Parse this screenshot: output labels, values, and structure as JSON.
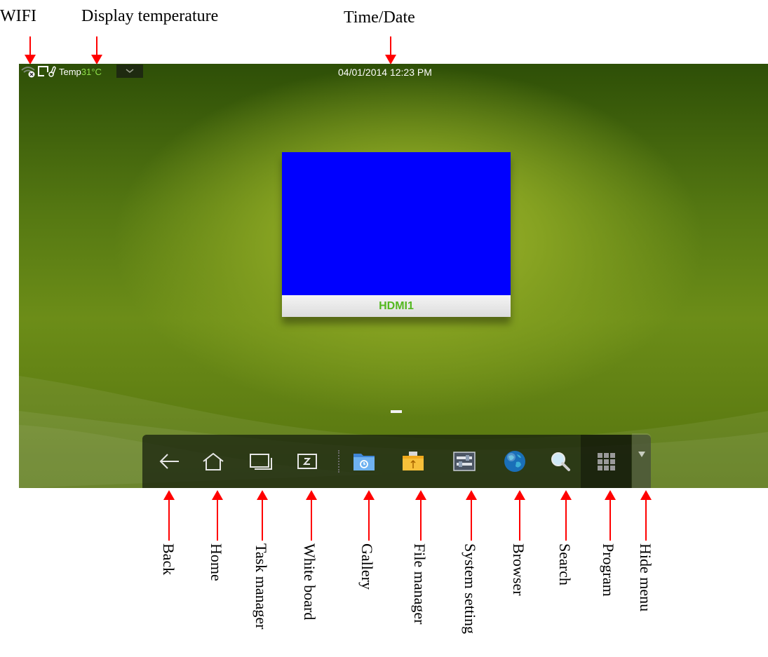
{
  "callouts": {
    "wifi": "WIFI",
    "display_temperature": "Display temperature",
    "time_date": "Time/Date",
    "back": "Back",
    "home": "Home",
    "task_manager": "Task manager",
    "white_board": "White board",
    "gallery": "Gallery",
    "file_manager": "File manager",
    "system_settings": "System setting",
    "browser": "Browser",
    "search": "Search",
    "program": "Program",
    "hide_menu": "Hide menu"
  },
  "statusbar": {
    "temp_label": "Temp",
    "temp_value": "31°C",
    "datetime": "04/01/2014 12:23  PM"
  },
  "source_card": {
    "label": "HDMI1"
  },
  "dock": {
    "icons": [
      "back-arrow-icon",
      "home-icon",
      "task-manager-icon",
      "whiteboard-icon",
      "gallery-folder-icon",
      "usb-folder-icon",
      "settings-icon",
      "globe-icon",
      "magnifier-icon",
      "app-grid-icon",
      "triangle-down-icon"
    ]
  },
  "colors": {
    "callout_arrow": "#ff0000",
    "temp_value": "#8ee04a",
    "source_label": "#53b81f",
    "preview_fill": "#0000ff"
  }
}
